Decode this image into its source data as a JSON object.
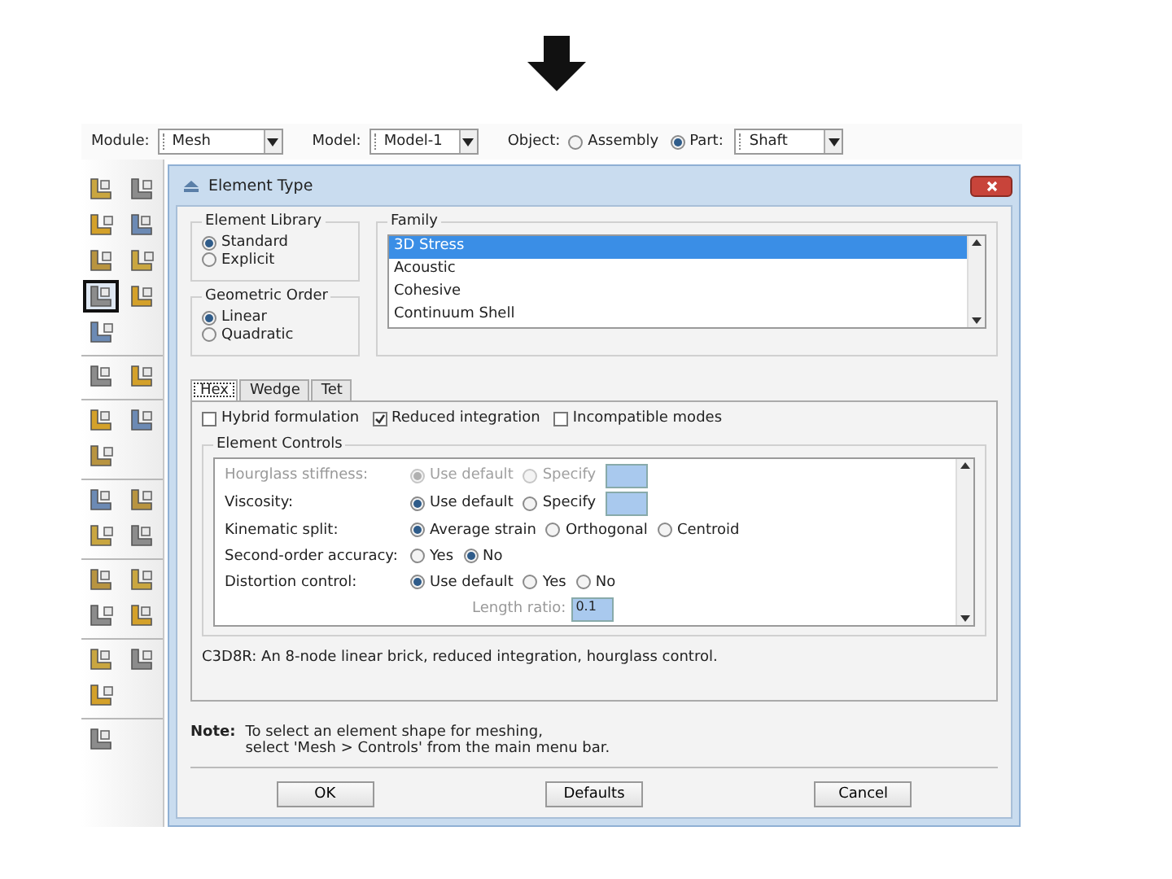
{
  "context_bar": {
    "module": {
      "label": "Module:",
      "value": "Mesh"
    },
    "model": {
      "label": "Model:",
      "value": "Model-1"
    },
    "object": {
      "label": "Object:",
      "options": [
        {
          "label": "Assembly",
          "selected": false
        },
        {
          "label": "Part:",
          "selected": true
        }
      ],
      "part_value": "Shaft"
    }
  },
  "toolbox": {
    "groups": [
      {
        "tools": [
          {
            "selected": false
          },
          {
            "selected": false
          },
          {
            "selected": false
          },
          {
            "selected": false
          },
          {
            "selected": false
          },
          {
            "selected": false
          },
          {
            "selected": true
          },
          {
            "selected": false
          },
          {
            "selected": false
          }
        ]
      },
      {
        "tools": [
          {
            "selected": false
          },
          {
            "selected": false
          }
        ]
      },
      {
        "tools": [
          {
            "selected": false
          },
          {
            "selected": false
          },
          {
            "selected": false
          }
        ]
      },
      {
        "tools": [
          {
            "selected": false
          },
          {
            "selected": false
          },
          {
            "selected": false
          },
          {
            "selected": false
          }
        ]
      },
      {
        "tools": [
          {
            "selected": false
          },
          {
            "selected": false
          },
          {
            "selected": false
          },
          {
            "selected": false
          }
        ]
      },
      {
        "tools": [
          {
            "selected": false
          },
          {
            "selected": false
          },
          {
            "selected": false
          }
        ]
      },
      {
        "tools": [
          {
            "selected": false
          }
        ]
      }
    ]
  },
  "dialog": {
    "title": "Element Type",
    "element_library": {
      "title": "Element Library",
      "options": [
        {
          "label": "Standard",
          "selected": true
        },
        {
          "label": "Explicit",
          "selected": false
        }
      ]
    },
    "geometric_order": {
      "title": "Geometric Order",
      "options": [
        {
          "label": "Linear",
          "selected": true
        },
        {
          "label": "Quadratic",
          "selected": false
        }
      ]
    },
    "family": {
      "title": "Family",
      "items": [
        {
          "label": "3D Stress",
          "selected": true
        },
        {
          "label": "Acoustic",
          "selected": false
        },
        {
          "label": "Cohesive",
          "selected": false
        },
        {
          "label": "Continuum Shell",
          "selected": false
        }
      ]
    },
    "tabs": [
      {
        "label": "Hex",
        "selected": true
      },
      {
        "label": "Wedge",
        "selected": false
      },
      {
        "label": "Tet",
        "selected": false
      }
    ],
    "options": [
      {
        "label": "Hybrid formulation",
        "checked": false
      },
      {
        "label": "Reduced integration",
        "checked": true
      },
      {
        "label": "Incompatible modes",
        "checked": false
      }
    ],
    "element_controls": {
      "title": "Element Controls",
      "rows": [
        {
          "kind": "radios",
          "label": "Hourglass stiffness:",
          "disabled": true,
          "field": true,
          "options": [
            {
              "label": "Use default",
              "selected": true
            },
            {
              "label": "Specify",
              "selected": false
            }
          ]
        },
        {
          "kind": "radios",
          "label": "Viscosity:",
          "disabled": false,
          "field": true,
          "options": [
            {
              "label": "Use default",
              "selected": true
            },
            {
              "label": "Specify",
              "selected": false
            }
          ]
        },
        {
          "kind": "radios",
          "label": "Kinematic split:",
          "disabled": false,
          "field": false,
          "options": [
            {
              "label": "Average strain",
              "selected": true
            },
            {
              "label": "Orthogonal",
              "selected": false
            },
            {
              "label": "Centroid",
              "selected": false
            }
          ]
        },
        {
          "kind": "radios",
          "label": "Second-order accuracy:",
          "disabled": false,
          "field": false,
          "options": [
            {
              "label": "Yes",
              "selected": false
            },
            {
              "label": "No",
              "selected": true
            }
          ]
        },
        {
          "kind": "radios",
          "label": "Distortion control:",
          "disabled": false,
          "field": false,
          "options": [
            {
              "label": "Use default",
              "selected": true
            },
            {
              "label": "Yes",
              "selected": false
            },
            {
              "label": "No",
              "selected": false
            }
          ]
        },
        {
          "kind": "field",
          "label": "Length ratio:",
          "disabled": true,
          "value": "0.1"
        }
      ]
    },
    "description": "C3D8R:  An 8-node linear brick, reduced integration, hourglass control.",
    "note": {
      "label": "Note:",
      "lines": [
        "To select an element shape for meshing,",
        "select 'Mesh > Controls' from the main menu bar."
      ]
    },
    "buttons": [
      "OK",
      "Defaults",
      "Cancel"
    ]
  }
}
